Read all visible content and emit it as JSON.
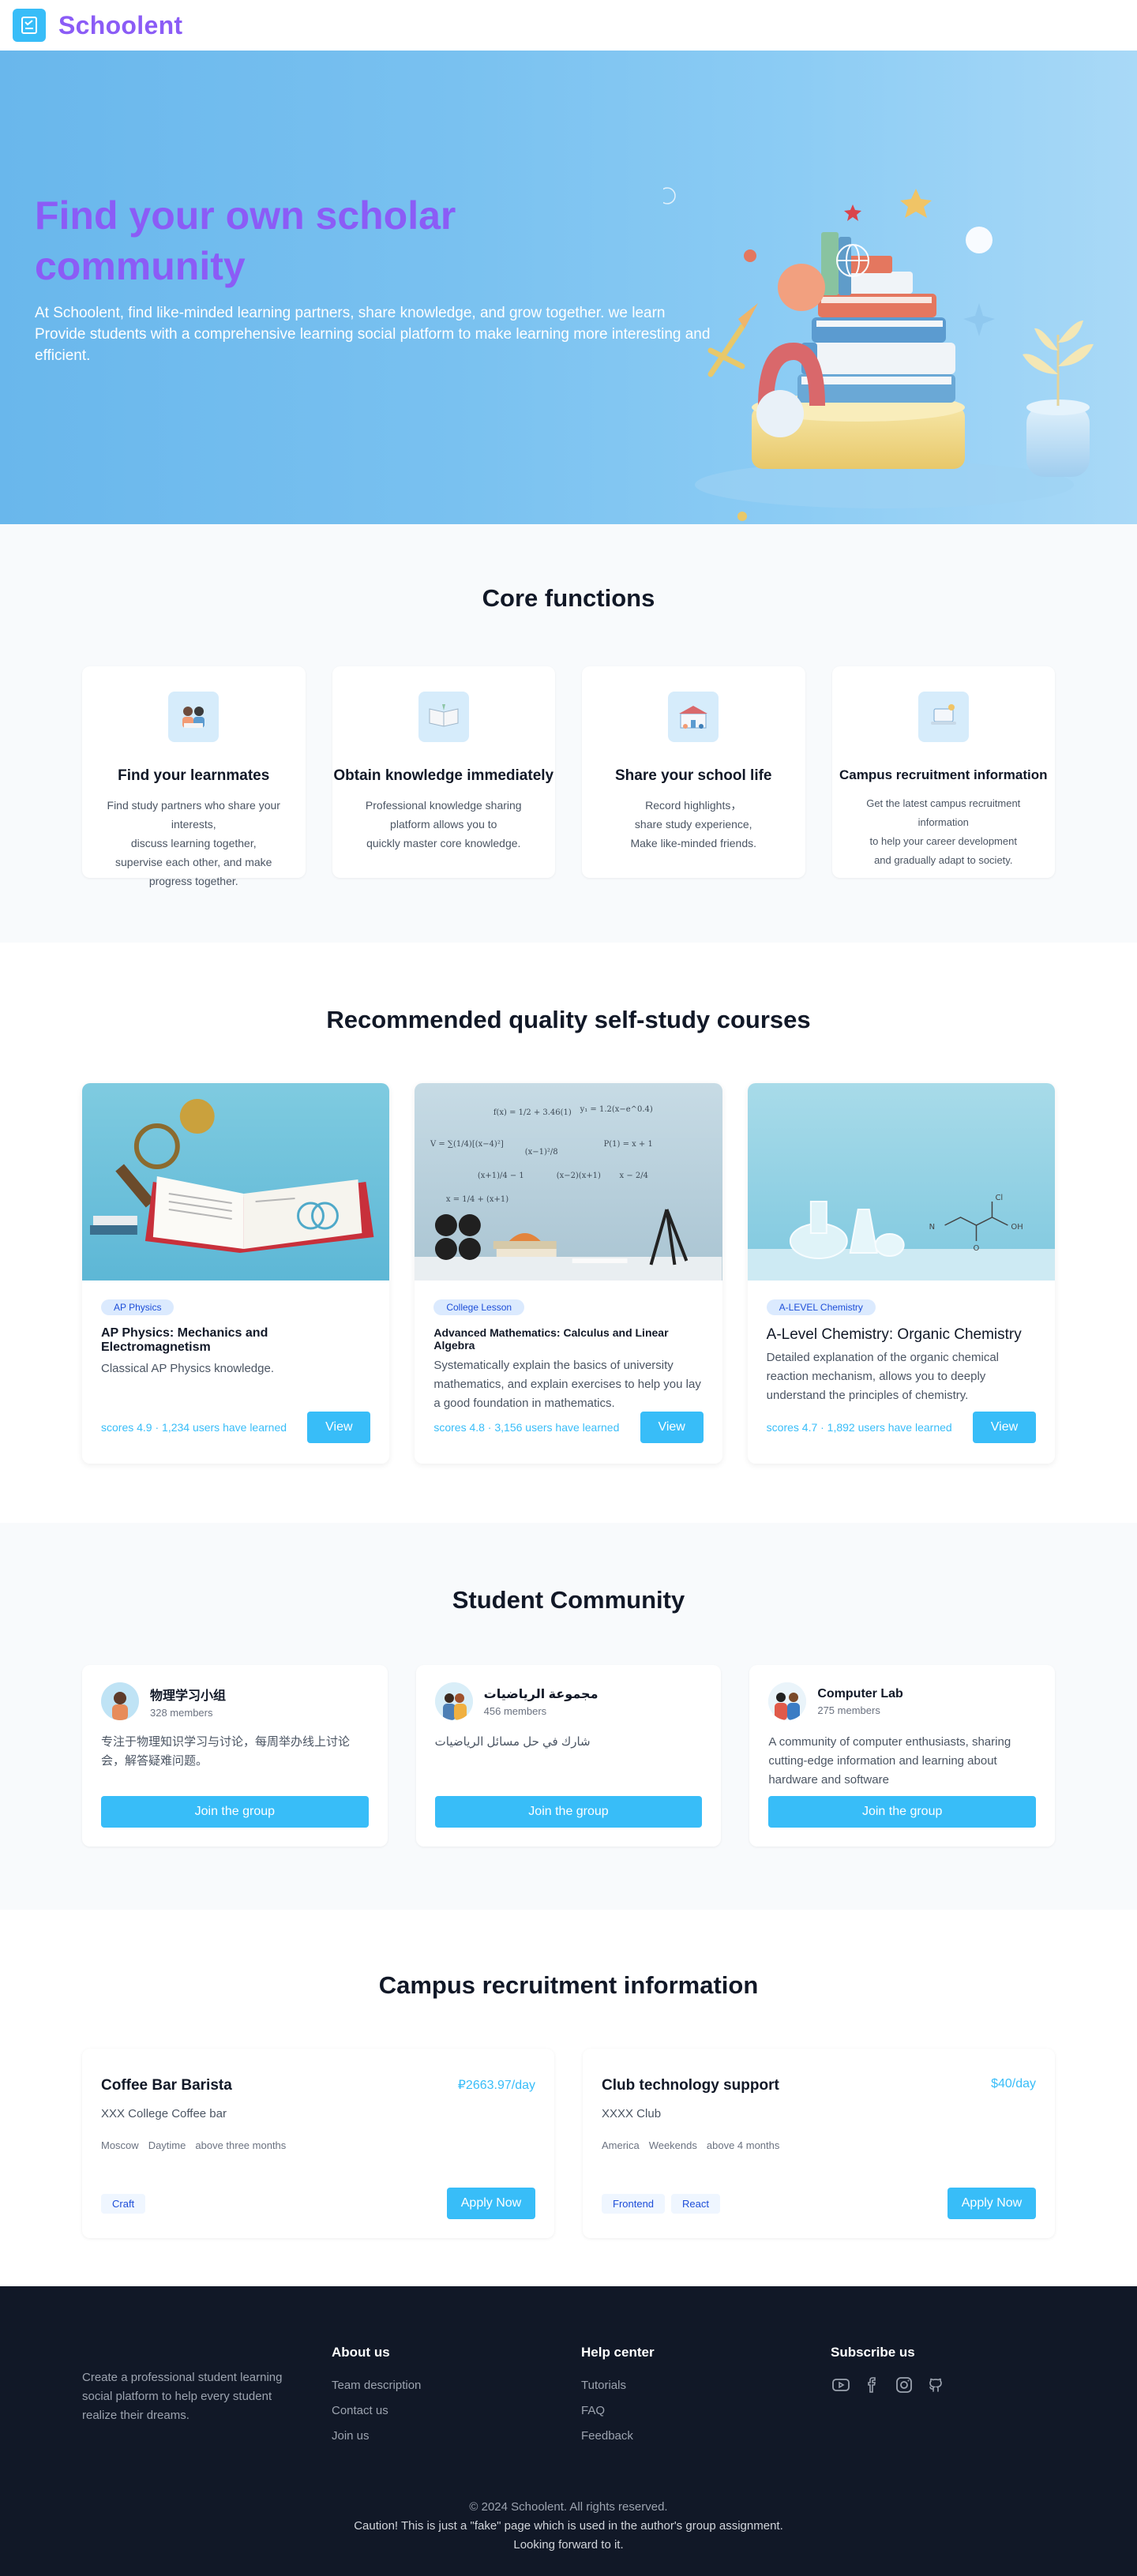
{
  "nav": {
    "brand": "Schoolent",
    "logo_icon": "book-icon"
  },
  "hero": {
    "title": "Find your own scholar community",
    "subtitle": "At Schoolent, find like-minded learning partners, share knowledge, and grow together. we learn Provide students with a comprehensive learning social platform to make learning more interesting and efficient."
  },
  "core": {
    "title": "Core functions",
    "items": [
      {
        "name": "Find your learnmates",
        "desc": "Find study partners who share your interests,\ndiscuss learning together,\nsupervise each other, and make\nprogress together.",
        "icon": "students-icon"
      },
      {
        "name": "Obtain knowledge immediately",
        "desc": "Professional knowledge sharing\nplatform allows you to\nquickly master core knowledge.",
        "icon": "book-open-icon"
      },
      {
        "name": "Share your school life",
        "desc": "Record highlights，\nshare study experience,\nMake like-minded friends.",
        "icon": "school-icon"
      },
      {
        "name": "Campus recruitment information",
        "desc": "Get the latest campus recruitment information\nto help your career development\nand gradually adapt to society.",
        "icon": "laptop-icon"
      }
    ]
  },
  "courses": {
    "title": "Recommended quality self-study courses",
    "items": [
      {
        "tag": "AP Physics",
        "name": "AP Physics: Mechanics and Electromagnetism",
        "desc": "Classical AP Physics knowledge.",
        "meta": "scores 4.9 · 1,234 users have learned",
        "button": "View"
      },
      {
        "tag": "College Lesson",
        "name": "Advanced Mathematics: Calculus and Linear Algebra",
        "desc": "Systematically explain the basics of university mathematics, and explain exercises to help you lay a good foundation in mathematics.",
        "meta": "scores 4.8 · 3,156  users have learned",
        "button": "View"
      },
      {
        "tag": "A-LEVEL Chemistry",
        "name": "A-Level Chemistry: Organic Chemistry",
        "desc": "Detailed explanation of the organic chemical reaction mechanism, allows you to deeply understand the principles of chemistry.",
        "meta": "scores 4.7 · 1,892 users have learned",
        "button": "View"
      }
    ]
  },
  "community": {
    "title": "Student Community",
    "items": [
      {
        "name": "物理学习小组",
        "count": "328 members",
        "desc": "专注于物理知识学习与讨论，每周举办线上讨论会，解答疑难问题。",
        "button": "Join the group"
      },
      {
        "name": "مجموعة الرياضيات",
        "count": "456 members",
        "desc": "شارك في حل مسائل الرياضيات",
        "button": "Join the group"
      },
      {
        "name": "Computer Lab",
        "count": "275 members",
        "desc": "A community of computer enthusiasts, sharing cutting-edge information and learning about hardware and software",
        "button": "Join the group"
      }
    ]
  },
  "jobs": {
    "title": "Campus recruitment information",
    "items": [
      {
        "title": "Coffee Bar Barista",
        "pay": "₽2663.97/day",
        "company": "XXX College Coffee bar",
        "info": [
          "Moscow",
          "Daytime",
          "above three months"
        ],
        "tags": [
          "Craft"
        ],
        "button": "Apply Now"
      },
      {
        "title": "Club technology support",
        "pay": "$40/day",
        "company": "XXXX  Club",
        "info": [
          "America",
          "Weekends",
          "above 4 months"
        ],
        "tags": [
          "Frontend",
          "React"
        ],
        "button": "Apply Now"
      }
    ]
  },
  "footer": {
    "about": "Create a professional student learning social platform to help every student realize their dreams.",
    "about_us": {
      "title": "About us",
      "links": [
        "Team description",
        "Contact us",
        "Join us"
      ]
    },
    "help": {
      "title": "Help center",
      "links": [
        "Tutorials",
        "FAQ",
        "Feedback"
      ]
    },
    "subscribe": {
      "title": "Subscribe us",
      "icons": [
        "youtube-icon",
        "facebook-icon",
        "instagram-icon",
        "github-icon"
      ]
    },
    "copyright": "© 2024 Schoolent. All rights reserved.",
    "caution": "Caution! This is just a \"fake\" page which is used in the author's group assignment.",
    "closing": "Looking forward to it."
  },
  "colors": {
    "brand": "#8b5cf6",
    "accent": "#38bdf8",
    "footer_bg": "#111827"
  }
}
